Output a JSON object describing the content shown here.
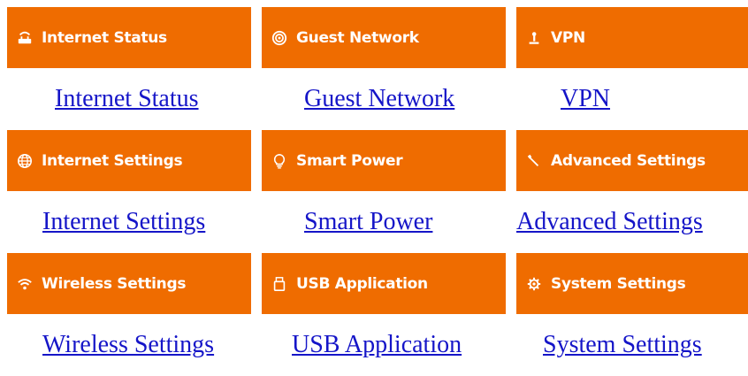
{
  "tiles": [
    {
      "label": "Internet Status",
      "link": "Internet Status",
      "icon": "router-icon"
    },
    {
      "label": "Guest Network",
      "link": "Guest Network",
      "icon": "guest-network-icon"
    },
    {
      "label": "VPN",
      "link": "VPN",
      "icon": "vpn-icon"
    },
    {
      "label": "Internet Settings",
      "link": "Internet Settings",
      "icon": "globe-icon"
    },
    {
      "label": "Smart Power",
      "link": "Smart Power",
      "icon": "bulb-icon"
    },
    {
      "label": "Advanced Settings",
      "link": "Advanced Settings",
      "icon": "wrench-icon"
    },
    {
      "label": "Wireless Settings",
      "link": "Wireless Settings",
      "icon": "wifi-icon"
    },
    {
      "label": "USB Application",
      "link": "USB Application",
      "icon": "usb-icon"
    },
    {
      "label": "System Settings",
      "link": "System Settings",
      "icon": "gear-icon"
    }
  ],
  "colors": {
    "tile_background": "#ef6c00",
    "tile_text": "#ffffff",
    "link": "#1515c8"
  }
}
